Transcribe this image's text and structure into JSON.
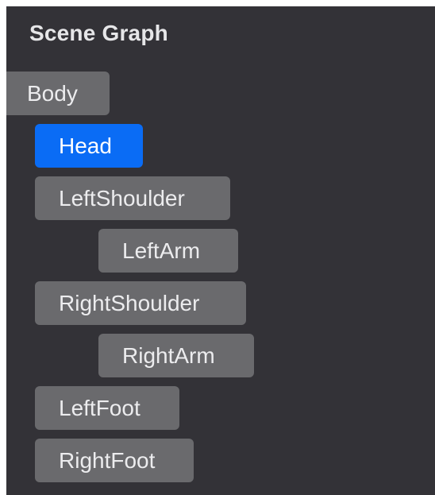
{
  "panel": {
    "title": "Scene Graph"
  },
  "nodes": [
    {
      "label": "Body",
      "depth": 0,
      "selected": false
    },
    {
      "label": "Head",
      "depth": 1,
      "selected": true
    },
    {
      "label": "LeftShoulder",
      "depth": 1,
      "selected": false
    },
    {
      "label": "LeftArm",
      "depth": 2,
      "selected": false
    },
    {
      "label": "RightShoulder",
      "depth": 1,
      "selected": false
    },
    {
      "label": "RightArm",
      "depth": 2,
      "selected": false
    },
    {
      "label": "LeftFoot",
      "depth": 1,
      "selected": false
    },
    {
      "label": "RightFoot",
      "depth": 1,
      "selected": false
    }
  ],
  "colors": {
    "panel_background": "#333237",
    "node_background": "#6a6a6d",
    "selected_background": "#0a6cf5",
    "text": "#ececee"
  }
}
